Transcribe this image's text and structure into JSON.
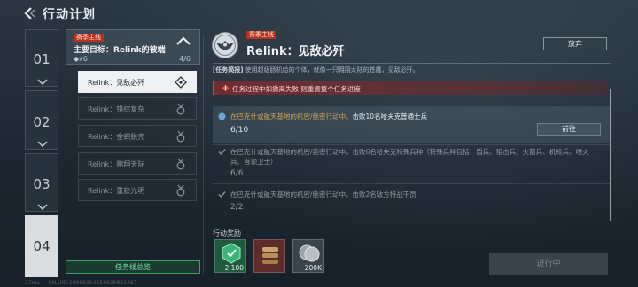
{
  "header": {
    "title": "行动计划"
  },
  "steps": [
    "01",
    "02",
    "03",
    "04"
  ],
  "quest": {
    "tag": "赛季主线",
    "title": "主要目标：Relink的彼端",
    "count": "◆x6",
    "progress": "4/6",
    "summary_button": "任务线总览"
  },
  "tasks": [
    {
      "label": "Relink：见敌必歼"
    },
    {
      "label": "Relink：错综复杂"
    },
    {
      "label": "Relink：金蝉脱壳"
    },
    {
      "label": "Relink：鹏翔天际"
    },
    {
      "label": "Relink：重获光明"
    }
  ],
  "detail": {
    "tag": "赛季主线",
    "title": "Relink：见敌必歼",
    "abandon": "放弃",
    "brief_label": "[任务简报]",
    "brief_text": "使用超级肠机给的个体，就像一只翱翔大陆的苍鹰，见敌必歼。",
    "warning": "任务过程中如撤离失败 则重置整个任务进度",
    "objectives": [
      {
        "location": "在巴克什或航天基地的机密/绝密行动中，",
        "desc": "击败10名哈夫克普通士兵",
        "progress": "6/10",
        "button": "前往"
      },
      {
        "text": "在巴克什或航天基地的机密/绝密行动中，击败6名哈夫克特殊兵种（特殊兵种包括：盾兵、狙击兵、火箭兵、机枪兵、喷火兵、首领卫士）",
        "progress": "6/6"
      },
      {
        "text": "在巴克什或航天基地的机密/绝密行动中，击败2名敌方特战干员",
        "progress": "2/2"
      }
    ],
    "rewards_label": "行动奖励",
    "rewards": [
      {
        "icon": "badge-icon",
        "amount": "2,100"
      },
      {
        "icon": "ammo-icon",
        "amount": ""
      },
      {
        "icon": "coin-icon",
        "amount": "200K"
      }
    ],
    "status_button": "进行中"
  },
  "footer": {
    "ping": "37ms",
    "uid": "CN.UID:18865954158609882487"
  },
  "colors": {
    "accent_green": "#3aa06a",
    "tag_red": "#b5321d",
    "objective_gold": "#c7a55a"
  }
}
